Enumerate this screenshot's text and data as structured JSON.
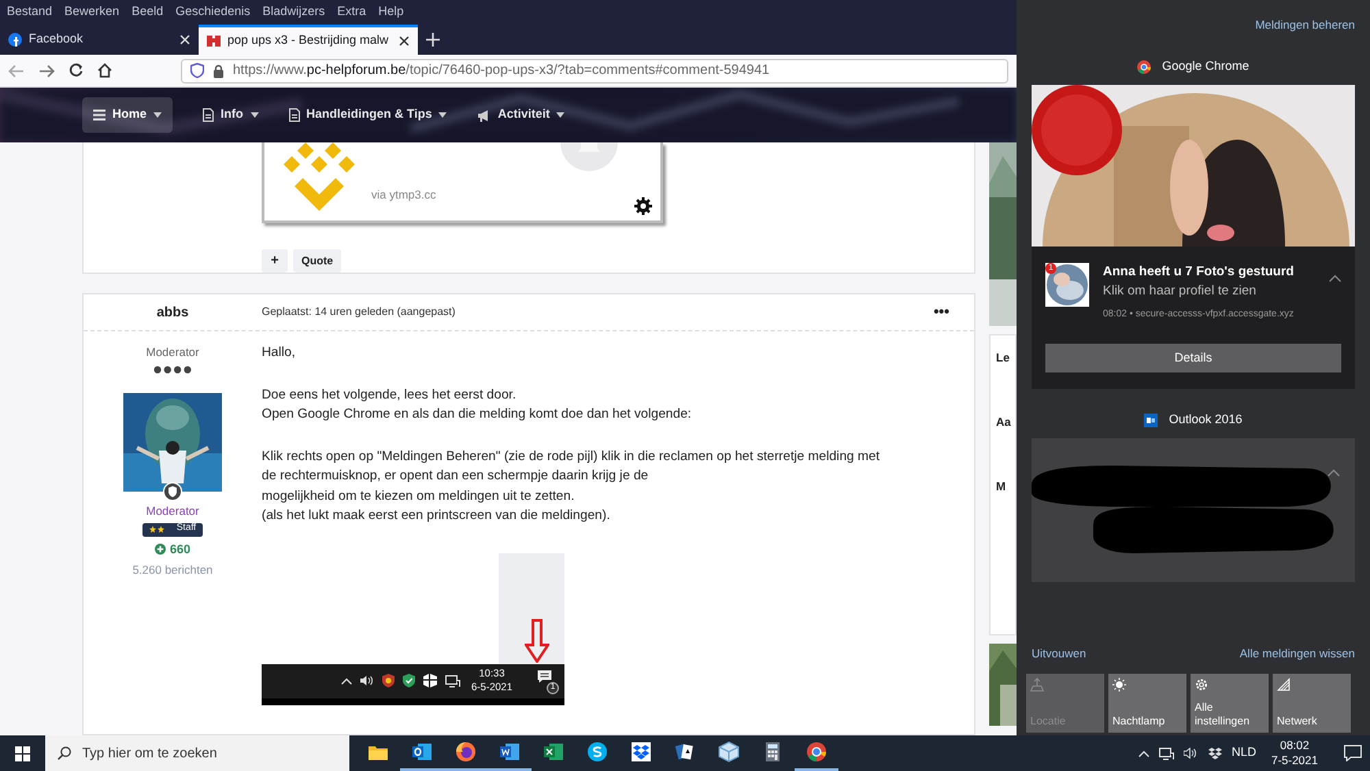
{
  "menu_bar": [
    "Bestand",
    "Bewerken",
    "Beeld",
    "Geschiedenis",
    "Bladwijzers",
    "Extra",
    "Help"
  ],
  "tabs": [
    {
      "title": "Facebook",
      "kind": "facebook",
      "selected": false
    },
    {
      "title": "pop ups x3 - Bestrijding malw",
      "kind": "forum",
      "selected": true
    }
  ],
  "address": {
    "prefix": "https://www.",
    "host": "pc-helpforum.be",
    "path": "/topic/76460-pop-ups-x3/?tab=comments#comment-594941"
  },
  "site_nav": [
    {
      "label": "Home",
      "kind": "list",
      "selected": true
    },
    {
      "label": "Info",
      "kind": "doc",
      "selected": false
    },
    {
      "label": "Handleidingen & Tips",
      "kind": "doc",
      "selected": false
    },
    {
      "label": "Activiteit",
      "kind": "megaphone",
      "selected": false
    }
  ],
  "previous_post": {
    "embedded_source": "via ytmp3.cc",
    "actions": [
      "+",
      "Quote"
    ]
  },
  "post": {
    "author": "abbs",
    "posted": "Geplaatst: 14 uren geleden (aangepast)",
    "options": "•••",
    "rank": "Moderator",
    "group": "Moderator",
    "badge": "Staff",
    "reputation": "660",
    "post_count": "5.260 berichten",
    "paragraphs": [
      [
        "Hallo,"
      ],
      [
        "Doe eens het volgende, lees het eerst door.",
        "Open Google Chrome en als dan die melding komt doe dan het volgende:"
      ],
      [
        "Klik rechts open op \"Meldingen Beheren\" (zie de rode pijl) klik in die reclamen op het sterretje melding met de rechtermuisknop, er opent dan een schermpje daarin krijg je de",
        "mogelijkheid om te kiezen om meldingen uit te zetten.",
        "(als het lukt maak eerst een printscreen van die meldingen)."
      ]
    ],
    "screenshot": {
      "time": "10:33",
      "date": "6-5-2021",
      "count": "1"
    }
  },
  "sidebar_fragments": [
    "Le",
    "Aa",
    "M"
  ],
  "action_center": {
    "manage": "Meldingen beheren",
    "groups": [
      {
        "app": "Google Chrome",
        "kind": "chrome",
        "notification": {
          "badge": "1",
          "title": "Anna heeft u 7 Foto's gestuurd",
          "text": "Klik om haar profiel te zien",
          "meta": "08:02 • secure-accesss-vfpxf.accessgate.xyz",
          "button": "Details"
        }
      },
      {
        "app": "Outlook 2016",
        "kind": "outlook",
        "redacted": true
      }
    ],
    "expand": "Uitvouwen",
    "clear": "Alle meldingen wissen",
    "quick_actions": [
      {
        "label": "Locatie",
        "kind": "location",
        "disabled": true
      },
      {
        "label": "Nachtlamp",
        "kind": "nightlight",
        "disabled": false
      },
      {
        "label": "Alle instellingen",
        "kind": "settings",
        "disabled": false
      },
      {
        "label": "Netwerk",
        "kind": "network",
        "disabled": false
      }
    ]
  },
  "taskbar": {
    "search_placeholder": "Typ hier om te zoeken",
    "apps": [
      {
        "kind": "explorer",
        "running": false
      },
      {
        "kind": "outlook",
        "running": true
      },
      {
        "kind": "firefox",
        "running": true
      },
      {
        "kind": "word",
        "running": true
      },
      {
        "kind": "excel",
        "running": false
      },
      {
        "kind": "skype",
        "running": false
      },
      {
        "kind": "dropbox",
        "running": false
      },
      {
        "kind": "cards",
        "running": false
      },
      {
        "kind": "cube",
        "running": false
      },
      {
        "kind": "calculator",
        "running": false
      },
      {
        "kind": "chrome",
        "running": true
      }
    ],
    "language": "NLD",
    "time": "08:02",
    "date": "7-5-2021"
  }
}
